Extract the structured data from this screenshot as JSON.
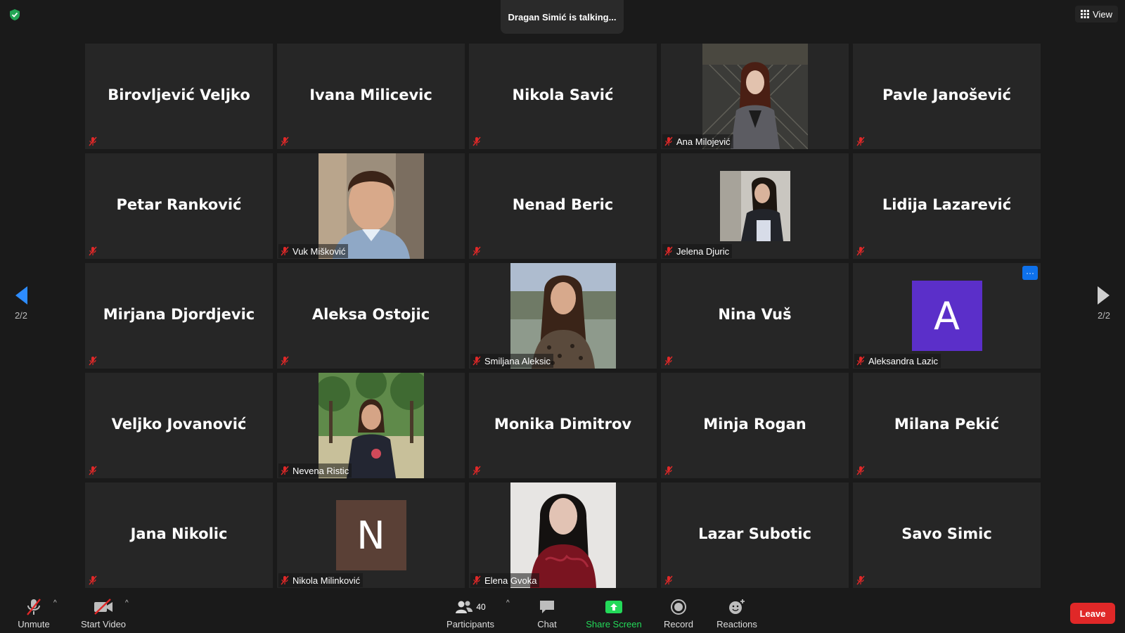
{
  "meeting": {
    "talking_text": "Dragan Simić is talking...",
    "view_label": "View",
    "page_indicator_left": "2/2",
    "page_indicator_right": "2/2"
  },
  "colors": {
    "background": "#1a1a1a",
    "tile": "#262626",
    "mute_red": "#e02828",
    "share_green": "#23d959",
    "accent_blue": "#0e71eb",
    "avatar_purple": "#5b2fc9",
    "avatar_brown": "#5a4036"
  },
  "tiles": [
    {
      "name": "Birovljević Veljko",
      "type": "name"
    },
    {
      "name": "Ivana Milicevic",
      "type": "name"
    },
    {
      "name": "Nikola Savić",
      "type": "name"
    },
    {
      "name": "Ana Milojević",
      "type": "photo"
    },
    {
      "name": "Pavle Janošević",
      "type": "name"
    },
    {
      "name": "Petar Ranković",
      "type": "name"
    },
    {
      "name": "Vuk Mišković",
      "type": "photo"
    },
    {
      "name": "Nenad Beric",
      "type": "name"
    },
    {
      "name": "Jelena Djuric",
      "type": "photo-small"
    },
    {
      "name": "Lidija Lazarević",
      "type": "name"
    },
    {
      "name": "Mirjana Djordjevic",
      "type": "name"
    },
    {
      "name": "Aleksa Ostojic",
      "type": "name"
    },
    {
      "name": "Smiljana Aleksic",
      "type": "photo"
    },
    {
      "name": "Nina Vuš",
      "type": "name"
    },
    {
      "name": "Aleksandra Lazic",
      "type": "avatar",
      "initial": "A",
      "more": "···"
    },
    {
      "name": "Veljko Jovanović",
      "type": "name"
    },
    {
      "name": "Nevena Ristic",
      "type": "photo"
    },
    {
      "name": "Monika Dimitrov",
      "type": "name"
    },
    {
      "name": "Minja Rogan",
      "type": "name"
    },
    {
      "name": "Milana Pekić",
      "type": "name"
    },
    {
      "name": "Jana Nikolic",
      "type": "name"
    },
    {
      "name": "Nikola Milinković",
      "type": "avatar",
      "initial": "N"
    },
    {
      "name": "Elena Gvoka",
      "type": "photo"
    },
    {
      "name": "Lazar Subotic",
      "type": "name"
    },
    {
      "name": "Savo Simic",
      "type": "name"
    }
  ],
  "toolbar": {
    "unmute_label": "Unmute",
    "start_video_label": "Start Video",
    "participants_label": "Participants",
    "participants_count": "40",
    "chat_label": "Chat",
    "share_screen_label": "Share Screen",
    "record_label": "Record",
    "reactions_label": "Reactions",
    "leave_label": "Leave"
  }
}
